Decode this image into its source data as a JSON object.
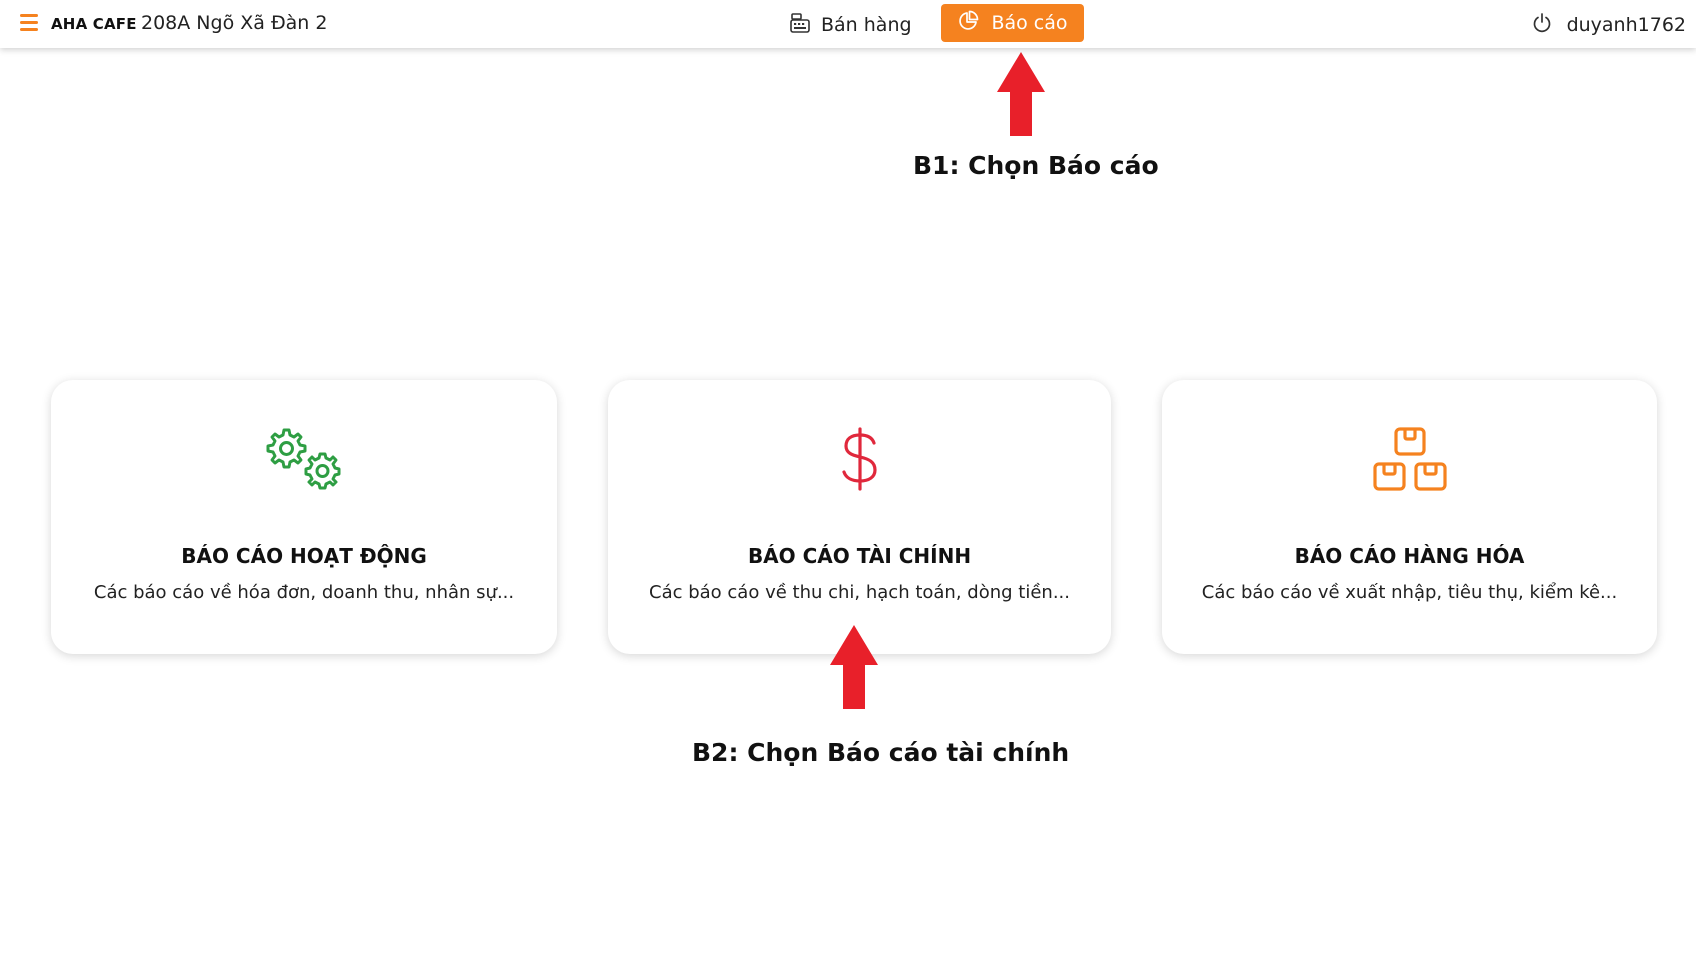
{
  "header": {
    "brand": "AHA CAFE",
    "store_name": "208A Ngõ Xã Đàn 2",
    "nav_sell_label": "Bán hàng",
    "nav_report_label": "Báo cáo",
    "username": "duyanh1762",
    "accent_color": "#f5821f"
  },
  "cards": [
    {
      "title": "BÁO CÁO HOẠT ĐỘNG",
      "description": "Các báo cáo về hóa đơn, doanh thu, nhân sự...",
      "icon": "gears-icon",
      "icon_color": "#2e9e43"
    },
    {
      "title": "BÁO CÁO TÀI CHÍNH",
      "description": "Các báo cáo về thu chi, hạch toán, dòng tiền...",
      "icon": "dollar-icon",
      "icon_color": "#e0283c"
    },
    {
      "title": "BÁO CÁO HÀNG HÓA",
      "description": "Các báo cáo về xuất nhập, tiêu thụ, kiểm kê...",
      "icon": "boxes-icon",
      "icon_color": "#f5821f"
    }
  ],
  "annotations": {
    "step1": "B1: Chọn Báo cáo",
    "step2": "B2: Chọn Báo cáo tài chính",
    "arrow_color": "#e8202a"
  }
}
